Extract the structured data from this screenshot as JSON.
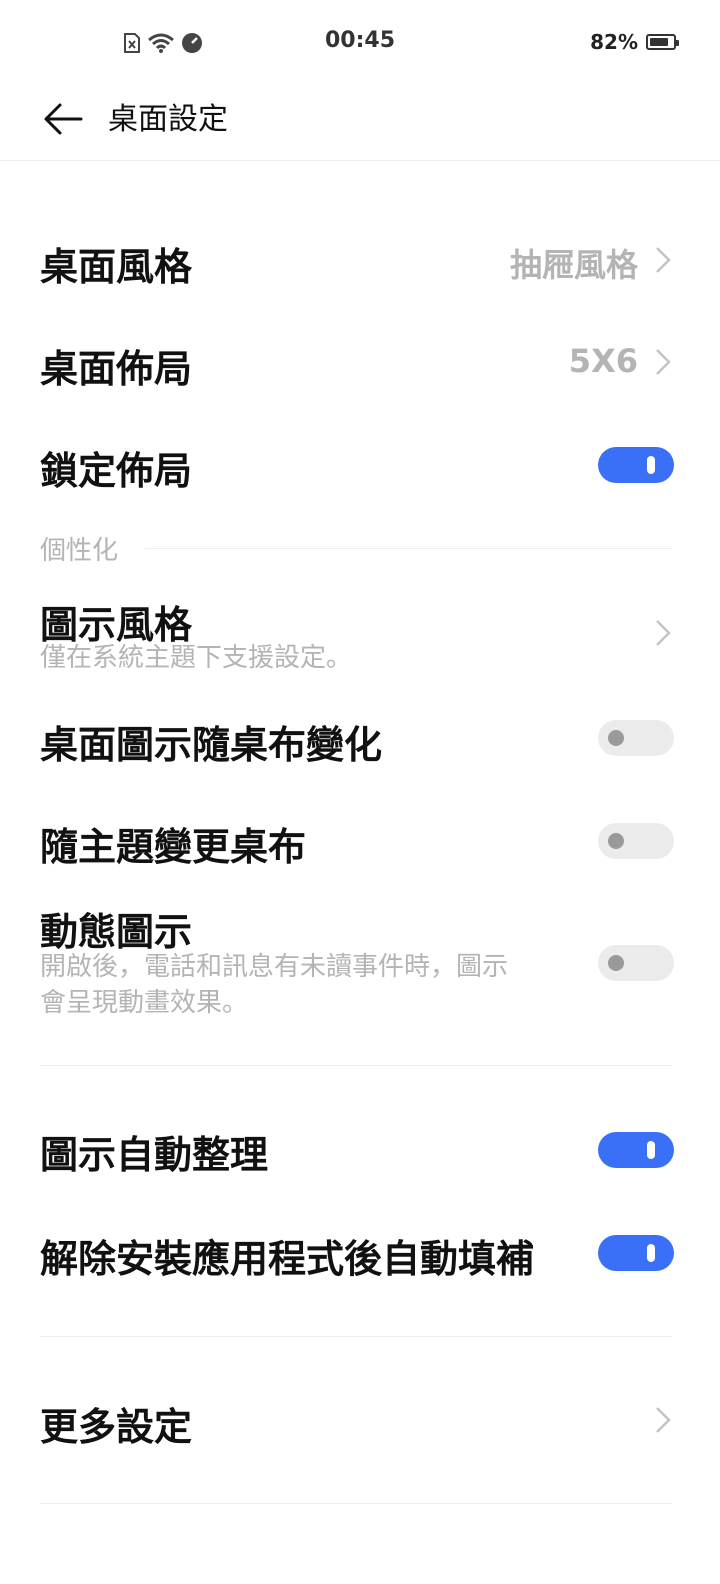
{
  "status_bar": {
    "time": "00:45",
    "battery_text": "82%",
    "battery_level": 0.82,
    "icons": [
      "sim-missing-icon",
      "wifi-icon",
      "speed-icon"
    ]
  },
  "header": {
    "title": "桌面設定",
    "back_icon": "back-arrow-icon"
  },
  "settings": {
    "desktop_style": {
      "label": "桌面風格",
      "value": "抽屜風格"
    },
    "desktop_layout": {
      "label": "桌面佈局",
      "value": "5X6"
    },
    "lock_layout": {
      "label": "鎖定佈局",
      "enabled": true
    },
    "personalization_header": "個性化",
    "icon_style": {
      "label": "圖示風格",
      "description": "僅在系統主題下支援設定。"
    },
    "icon_follow_wallpaper": {
      "label": "桌面圖示隨桌布變化",
      "enabled": false
    },
    "wallpaper_follow_theme": {
      "label": "隨主題變更桌布",
      "enabled": false
    },
    "dynamic_icons": {
      "label": "動態圖示",
      "description_line1": "開啟後，電話和訊息有未讀事件時，圖示",
      "description_line2": "會呈現動畫效果。",
      "enabled": false
    },
    "auto_arrange": {
      "label": "圖示自動整理",
      "enabled": true
    },
    "auto_fill": {
      "label": "解除安裝應用程式後自動填補",
      "enabled": true
    },
    "more_settings": {
      "label": "更多設定"
    }
  },
  "colors": {
    "accent": "#3a6ff7",
    "secondary_text": "#b4b4b4",
    "toggle_off": "#ebebeb"
  }
}
